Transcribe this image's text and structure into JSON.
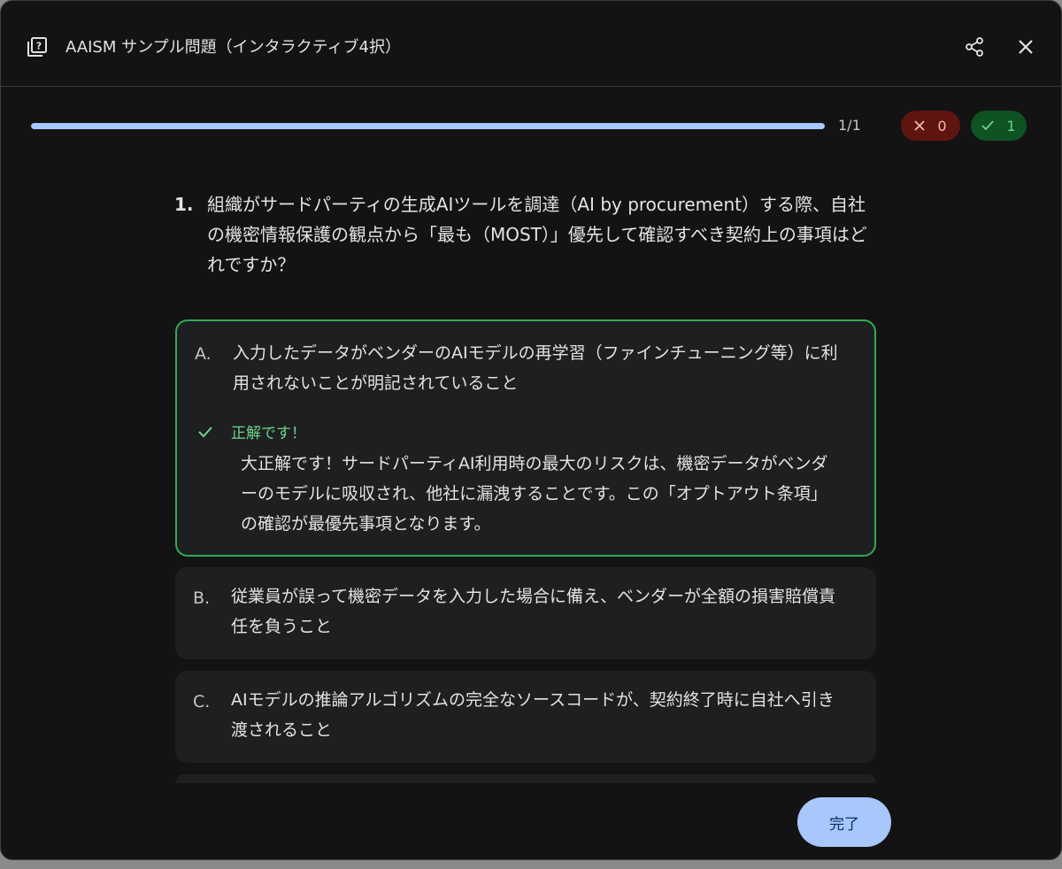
{
  "header": {
    "title": "AAISM サンプル問題（インタラクティブ4択）",
    "quiz_icon": "quiz-icon",
    "share_icon": "share-icon",
    "close_icon": "close-icon"
  },
  "progress": {
    "fraction": 1.0,
    "label": "1/1"
  },
  "score": {
    "wrong_count": "0",
    "correct_count": "1",
    "wrong_color": "#f2b8b5",
    "correct_color": "#6dd58c"
  },
  "question": {
    "number": "1.",
    "text": "組織がサードパーティの生成AIツールを調達（AI by procurement）する際、自社の機密情報保護の観点から「最も（MOST）」優先して確認すべき契約上の事項はどれですか？"
  },
  "options": [
    {
      "letter": "A.",
      "text": "入力したデータがベンダーのAIモデルの再学習（ファインチューニング等）に利用されないことが明記されていること",
      "state": "correct",
      "feedback_label": "正解です！",
      "feedback_text": "大正解です！サードパーティAI利用時の最大のリスクは、機密データがベンダーのモデルに吸収され、他社に漏洩することです。この「オプトアウト条項」の確認が最優先事項となります。"
    },
    {
      "letter": "B.",
      "text": "従業員が誤って機密データを入力した場合に備え、ベンダーが全額の損害賠償責任を負うこと"
    },
    {
      "letter": "C.",
      "text": "AIモデルの推論アルゴリズムの完全なソースコードが、契約終了時に自社へ引き渡されること"
    }
  ],
  "footer": {
    "done_label": "完了"
  },
  "colors": {
    "accent": "#a8c7fa",
    "correct_border": "#34a853",
    "background": "#131314",
    "card": "#1e1f20"
  }
}
